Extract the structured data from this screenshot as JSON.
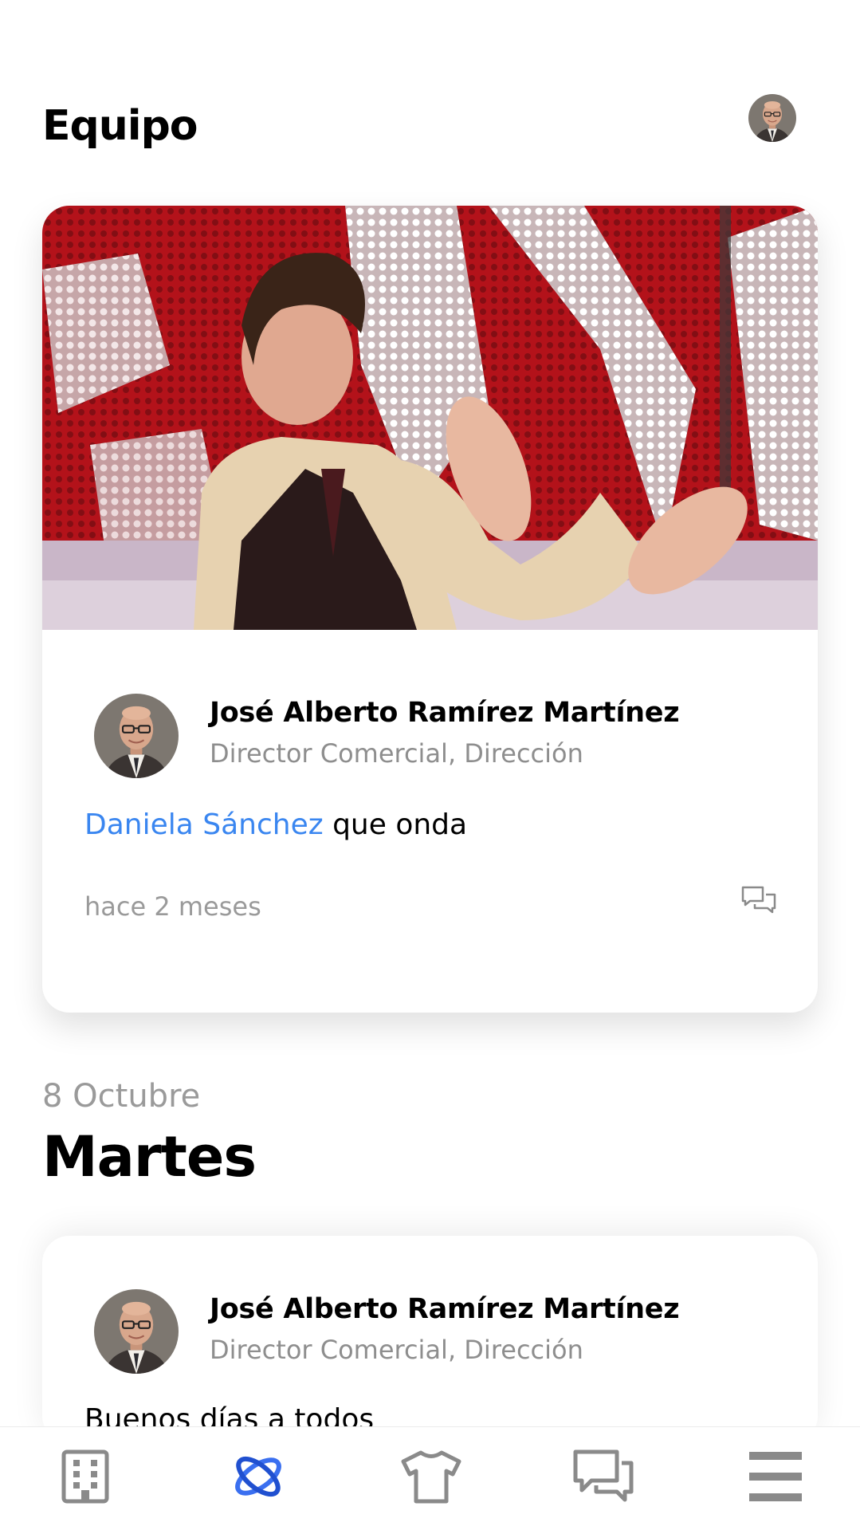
{
  "header": {
    "title": "Equipo"
  },
  "posts": [
    {
      "author": "José Alberto Ramírez Martínez",
      "role": "Director Comercial, Dirección",
      "mention": "Daniela Sánchez",
      "text": " que onda",
      "time": "hace 2 meses",
      "media": "gif-clapping-man"
    },
    {
      "author": "José Alberto Ramírez Martínez",
      "role": "Director Comercial, Dirección",
      "text": "Buenos días a todos"
    }
  ],
  "section": {
    "date": "8 Octubre",
    "day": "Martes"
  },
  "tabbar": {
    "items": [
      {
        "icon": "building-icon",
        "active": false
      },
      {
        "icon": "orbit-icon",
        "active": true
      },
      {
        "icon": "shirt-icon",
        "active": false
      },
      {
        "icon": "chat-icon",
        "active": false
      },
      {
        "icon": "menu-icon",
        "active": false
      }
    ],
    "active_color": "#3a6ff0",
    "inactive_color": "#8a8a8a"
  },
  "colors": {
    "mention": "#3a86f0",
    "secondary_text": "#8e8e8e"
  }
}
